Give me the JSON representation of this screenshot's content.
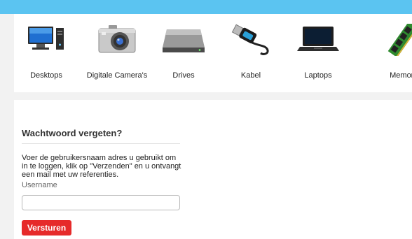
{
  "categories": [
    {
      "label": "Desktops",
      "icon": "desktop-computer-icon"
    },
    {
      "label": "Digitale Camera's",
      "icon": "digital-camera-icon"
    },
    {
      "label": "Drives",
      "icon": "hard-drive-icon"
    },
    {
      "label": "Kabel",
      "icon": "usb-cable-icon"
    },
    {
      "label": "Laptops",
      "icon": "laptop-icon"
    },
    {
      "label": "Memory",
      "icon": "memory-module-icon"
    }
  ],
  "forgot_password": {
    "title": "Wachtwoord vergeten?",
    "description": "Voer de gebruikersnaam adres u gebruikt om in te loggen, klik op \"Verzenden\" en u ontvangt een mail met uw referenties.",
    "username_label": "Username",
    "username_value": "",
    "submit_label": "Versturen"
  },
  "colors": {
    "top_bar": "#5bc4f1",
    "submit_button": "#e62a2a"
  }
}
